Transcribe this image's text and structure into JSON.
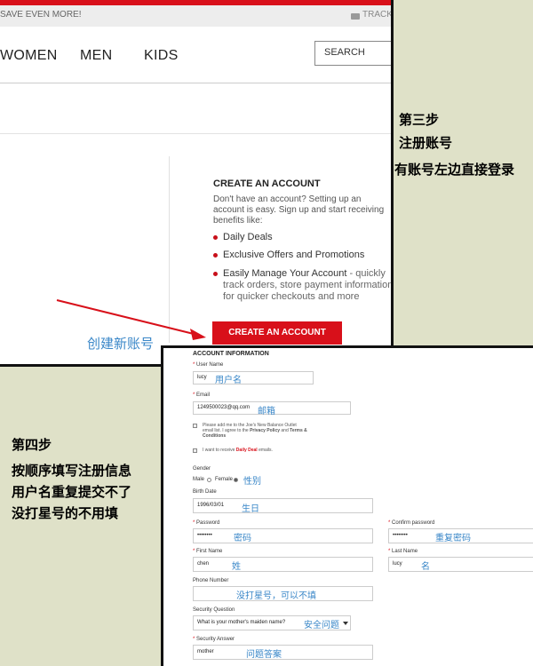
{
  "site": {
    "promo": "SAVE EVEN MORE!",
    "track": "TRACK",
    "nav": [
      "WOMEN",
      "MEN",
      "KIDS"
    ],
    "search_placeholder": "SEARCH"
  },
  "create_account": {
    "title": "CREATE AN ACCOUNT",
    "description": "Don't have an account? Setting up an account is easy. Sign up and start receiving benefits like:",
    "benefits": [
      {
        "text": "Daily Deals",
        "sub": ""
      },
      {
        "text": "Exclusive Offers and Promotions",
        "sub": ""
      },
      {
        "text": "Easily Manage Your Account",
        "suffix": " - quickly",
        "sub1": "track orders, store payment information",
        "sub2": "for quicker checkouts and more"
      }
    ],
    "button": "CREATE AN ACCOUNT"
  },
  "annotations": {
    "create_new_account": "创建新账号",
    "step3_line1": "第三步",
    "step3_line2": "注册账号",
    "step3_line3": "有账号左边直接登录",
    "step4_line1": "第四步",
    "step4_line2": "按顺序填写注册信息",
    "step4_line3": "用户名重复提交不了",
    "step4_line4": "没打星号的不用填"
  },
  "form": {
    "section_title": "ACCOUNT INFORMATION",
    "user_name": {
      "label": "User Name",
      "value": "lucy",
      "note": "用户名"
    },
    "email": {
      "label": "Email",
      "value": "1249500023@qq.com",
      "note": "邮箱"
    },
    "newsletter": {
      "text1": "Please add me to the Joe's New Balance Outlet",
      "text2": "email list. I agree to the",
      "privacy": "Privacy Policy",
      "and": "and",
      "terms": "Terms &",
      "conditions": "Conditions"
    },
    "daily_deal": {
      "prefix": "I want to receive",
      "link": "Daily Deal",
      "suffix": "emails."
    },
    "gender": {
      "label": "Gender",
      "male": "Male",
      "female": "Female",
      "note": "性别"
    },
    "birth_date": {
      "label": "Birth Date",
      "value": "1996/03/01",
      "note": "生日"
    },
    "password": {
      "label": "Password",
      "value": "••••••••",
      "note": "密码"
    },
    "confirm_password": {
      "label": "Confirm password",
      "value": "••••••••",
      "note": "重复密码"
    },
    "first_name": {
      "label": "First Name",
      "value": "chen",
      "note": "姓"
    },
    "last_name": {
      "label": "Last Name",
      "value": "lucy",
      "note": "名"
    },
    "phone": {
      "label": "Phone Number",
      "note": "没打星号，可以不填"
    },
    "security_question": {
      "label": "Security Question",
      "value": "What is your mother's maiden name?",
      "note": "安全问题"
    },
    "security_answer": {
      "label": "Security Answer",
      "value": "mother",
      "note": "问题答案"
    }
  },
  "colors": {
    "brand_red": "#d8101a",
    "annotation_blue": "#3a87c8",
    "background": "#dfe1c8"
  }
}
